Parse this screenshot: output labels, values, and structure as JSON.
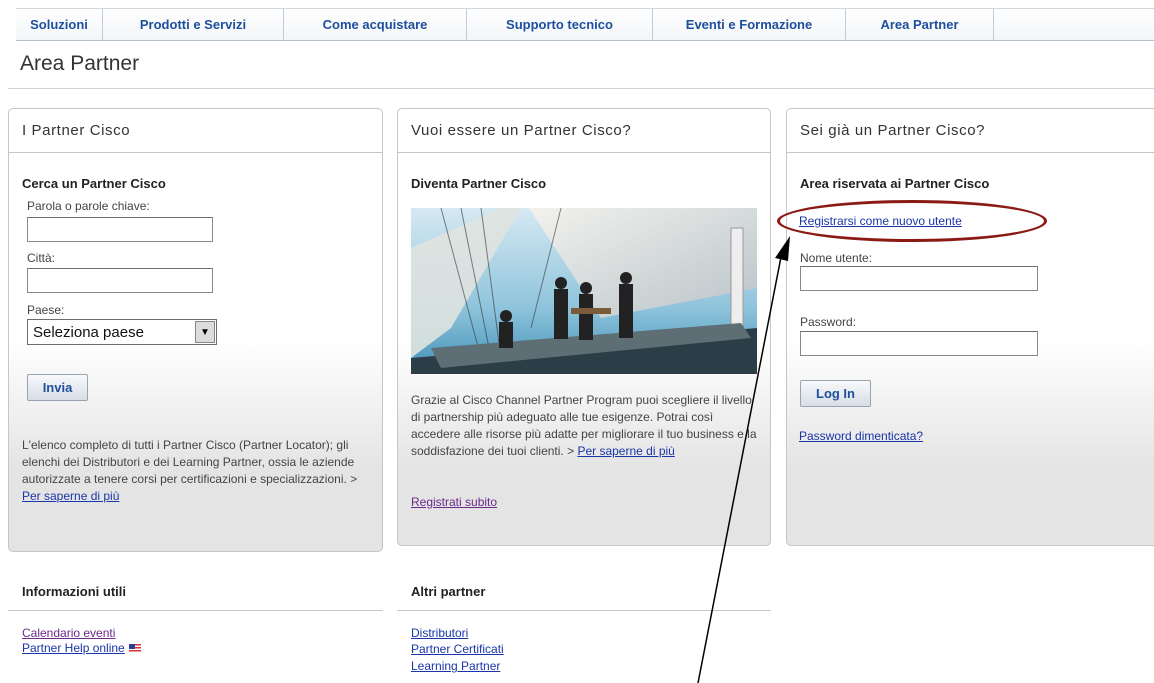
{
  "nav": {
    "tabs": [
      "Soluzioni",
      "Prodotti e Servizi",
      "Come acquistare",
      "Supporto tecnico",
      "Eventi e Formazione",
      "Area Partner"
    ]
  },
  "page": {
    "title": "Area Partner"
  },
  "panel_partners": {
    "header": "I Partner Cisco",
    "subtitle": "Cerca un Partner Cisco",
    "keywords_label": "Parola o parole chiave:",
    "keywords_value": "",
    "city_label": "Città:",
    "city_value": "",
    "country_label": "Paese:",
    "country_selected": "Seleziona paese",
    "submit_label": "Invia",
    "description": "L'elenco completo di tutti i Partner Cisco (Partner Locator); gli elenchi dei Distributori e dei Learning Partner, ossia le aziende autorizzate a tenere corsi per certificazioni e specializzazioni. >",
    "more_link": "Per saperne di più"
  },
  "panel_become": {
    "header": "Vuoi essere un Partner Cisco?",
    "subtitle": "Diventa Partner Cisco",
    "description": "Grazie al Cisco Channel Partner Program puoi scegliere il livello di partnership più adeguato alle tue esigenze. Potrai così accedere alle risorse più adatte per migliorare il tuo business e la soddisfazione dei tuoi clienti. >",
    "more_link": "Per saperne di più",
    "register_link": "Registrati subito"
  },
  "panel_login": {
    "header": "Sei già un Partner Cisco?",
    "subtitle": "Area riservata ai Partner Cisco",
    "register_link": "Registrarsi come nuovo utente",
    "username_label": "Nome utente:",
    "username_value": "",
    "password_label": "Password:",
    "password_value": "",
    "login_label": "Log In",
    "forgot_link": "Password dimenticata?"
  },
  "info": {
    "header": "Informazioni utili",
    "links": [
      "Calendario eventi",
      "Partner Help online"
    ]
  },
  "other": {
    "header": "Altri partner",
    "links": [
      "Distributori",
      "Partner Certificati",
      "Learning Partner"
    ]
  },
  "colors": {
    "nav_link": "#1e4f9c",
    "annotation": "#8b1a14",
    "link": "#1a35a8"
  }
}
